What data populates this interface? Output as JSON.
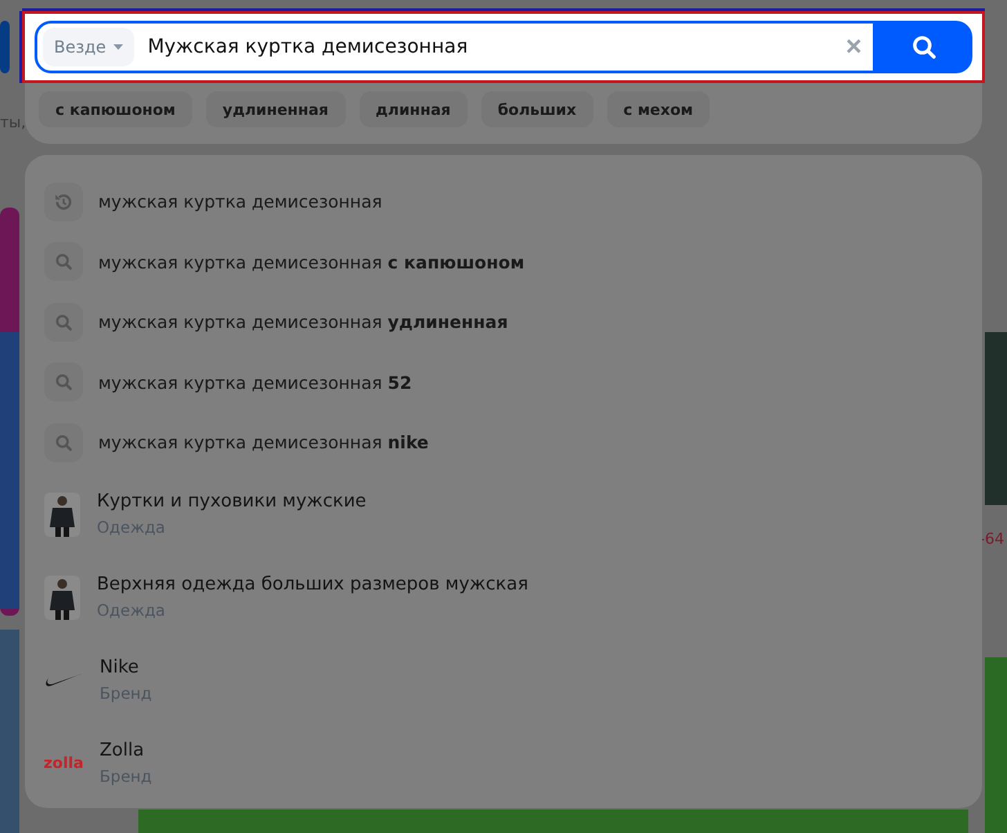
{
  "backdrop": {
    "fragments": [
      "ты,",
      "-64"
    ]
  },
  "search": {
    "scope": "Везде",
    "value": "Мужская куртка демисезонная",
    "clear": "×"
  },
  "chips": [
    {
      "label": "с капюшоном"
    },
    {
      "label": "удлиненная"
    },
    {
      "label": "длинная"
    },
    {
      "label": "больших"
    },
    {
      "label": "с мехом"
    }
  ],
  "suggestions": [
    {
      "kind": "history",
      "text": "мужская куртка демисезонная"
    },
    {
      "kind": "search",
      "text": "мужская куртка демисезонная **с капюшоном**"
    },
    {
      "kind": "search",
      "text": "мужская куртка демисезонная **удлиненная**"
    },
    {
      "kind": "search",
      "text": "мужская куртка демисезонная **52**"
    },
    {
      "kind": "search",
      "text": "мужская куртка демисезонная **nike**"
    },
    {
      "kind": "category",
      "title": "Куртки и пуховики мужские",
      "subtitle": "Одежда"
    },
    {
      "kind": "category",
      "title": "Верхняя одежда больших размеров мужская",
      "subtitle": "Одежда"
    },
    {
      "kind": "brand",
      "title": "Nike",
      "subtitle": "Бренд"
    },
    {
      "kind": "brand",
      "logo_text": "zolla",
      "title": "Zolla",
      "subtitle": "Бренд"
    }
  ]
}
